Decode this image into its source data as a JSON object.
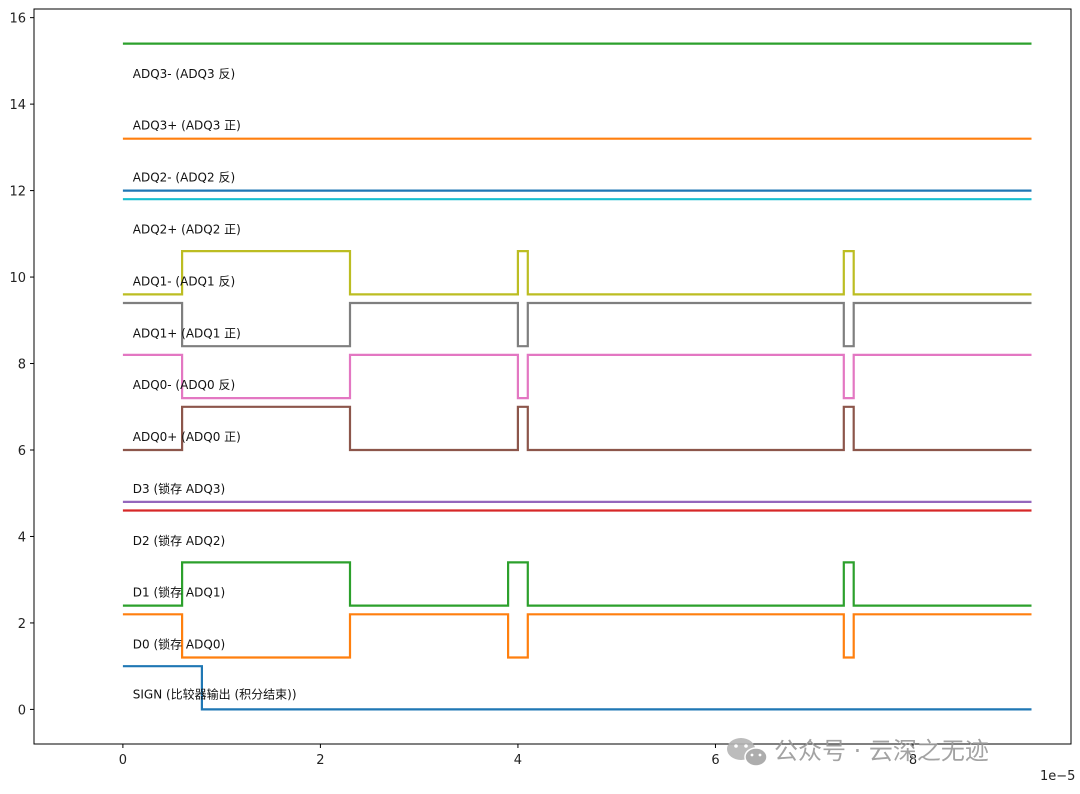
{
  "chart_data": {
    "type": "line",
    "title": "",
    "xlabel": "",
    "ylabel": "",
    "x_scale_label": "1e−5",
    "xlim": [
      -9e-06,
      9.6e-05
    ],
    "ylim": [
      -0.8,
      16.2
    ],
    "x_ticks": [
      0,
      2e-05,
      4e-05,
      6e-05,
      8e-05
    ],
    "x_tick_labels": [
      "0",
      "2",
      "4",
      "6",
      "8"
    ],
    "y_ticks": [
      0,
      2,
      4,
      6,
      8,
      10,
      12,
      14,
      16
    ],
    "y_tick_labels": [
      "0",
      "2",
      "4",
      "6",
      "8",
      "10",
      "12",
      "14",
      "16"
    ],
    "grid": false,
    "legend": "none",
    "signal_labels": [
      {
        "text": "SIGN (比较器输出 (积分结束))",
        "y": 0.35
      },
      {
        "text": "D0 (锁存 ADQ0)",
        "y": 1.5
      },
      {
        "text": "D1 (锁存 ADQ1)",
        "y": 2.7
      },
      {
        "text": "D2 (锁存 ADQ2)",
        "y": 3.9
      },
      {
        "text": "D3 (锁存 ADQ3)",
        "y": 5.1
      },
      {
        "text": "ADQ0+ (ADQ0 正)",
        "y": 6.3
      },
      {
        "text": "ADQ0- (ADQ0 反)",
        "y": 7.5
      },
      {
        "text": "ADQ1+ (ADQ1 正)",
        "y": 8.7
      },
      {
        "text": "ADQ1- (ADQ1 反)",
        "y": 9.9
      },
      {
        "text": "ADQ2+ (ADQ2 正)",
        "y": 11.1
      },
      {
        "text": "ADQ2- (ADQ2 反)",
        "y": 12.3
      },
      {
        "text": "ADQ3+ (ADQ3 正)",
        "y": 13.5
      },
      {
        "text": "ADQ3- (ADQ3 反)",
        "y": 14.7
      }
    ],
    "series": [
      {
        "color": "#1f77b4",
        "x": [
          0,
          8e-06,
          8e-06,
          9.2e-05
        ],
        "y": [
          1,
          1,
          0,
          0
        ]
      },
      {
        "color": "#ff7f0e",
        "x": [
          0,
          6e-06,
          6e-06,
          2.3e-05,
          2.3e-05,
          3.9e-05,
          3.9e-05,
          4.1e-05,
          4.1e-05,
          7.3e-05,
          7.3e-05,
          7.4e-05,
          7.4e-05,
          9.2e-05
        ],
        "y": [
          2.2,
          2.2,
          1.2,
          1.2,
          2.2,
          2.2,
          1.2,
          1.2,
          2.2,
          2.2,
          1.2,
          1.2,
          2.2,
          2.2
        ]
      },
      {
        "color": "#2ca02c",
        "x": [
          0,
          6e-06,
          6e-06,
          2.3e-05,
          2.3e-05,
          3.9e-05,
          3.9e-05,
          4.1e-05,
          4.1e-05,
          7.3e-05,
          7.3e-05,
          7.4e-05,
          7.4e-05,
          9.2e-05
        ],
        "y": [
          2.4,
          2.4,
          3.4,
          3.4,
          2.4,
          2.4,
          3.4,
          3.4,
          2.4,
          2.4,
          3.4,
          3.4,
          2.4,
          2.4
        ]
      },
      {
        "color": "#d62728",
        "x": [
          0,
          9.2e-05
        ],
        "y": [
          4.6,
          4.6
        ]
      },
      {
        "color": "#9467bd",
        "x": [
          0,
          9.2e-05
        ],
        "y": [
          4.8,
          4.8
        ]
      },
      {
        "color": "#8c564b",
        "x": [
          0,
          6e-06,
          6e-06,
          2.3e-05,
          2.3e-05,
          4e-05,
          4e-05,
          4.1e-05,
          4.1e-05,
          7.3e-05,
          7.3e-05,
          7.4e-05,
          7.4e-05,
          9.2e-05
        ],
        "y": [
          6,
          6,
          7,
          7,
          6,
          6,
          7,
          7,
          6,
          6,
          7,
          7,
          6,
          6
        ]
      },
      {
        "color": "#e377c2",
        "x": [
          0,
          6e-06,
          6e-06,
          2.3e-05,
          2.3e-05,
          4e-05,
          4e-05,
          4.1e-05,
          4.1e-05,
          7.3e-05,
          7.3e-05,
          7.4e-05,
          7.4e-05,
          9.2e-05
        ],
        "y": [
          8.2,
          8.2,
          7.2,
          7.2,
          8.2,
          8.2,
          7.2,
          7.2,
          8.2,
          8.2,
          7.2,
          7.2,
          8.2,
          8.2
        ]
      },
      {
        "color": "#7f7f7f",
        "x": [
          0,
          6e-06,
          6e-06,
          2.3e-05,
          2.3e-05,
          4e-05,
          4e-05,
          4.1e-05,
          4.1e-05,
          7.3e-05,
          7.3e-05,
          7.4e-05,
          7.4e-05,
          9.2e-05
        ],
        "y": [
          9.4,
          9.4,
          8.4,
          8.4,
          9.4,
          9.4,
          8.4,
          8.4,
          9.4,
          9.4,
          8.4,
          8.4,
          9.4,
          9.4
        ]
      },
      {
        "color": "#bcbd22",
        "x": [
          0,
          6e-06,
          6e-06,
          2.3e-05,
          2.3e-05,
          4e-05,
          4e-05,
          4.1e-05,
          4.1e-05,
          7.3e-05,
          7.3e-05,
          7.4e-05,
          7.4e-05,
          9.2e-05
        ],
        "y": [
          9.6,
          9.6,
          10.6,
          10.6,
          9.6,
          9.6,
          10.6,
          10.6,
          9.6,
          9.6,
          10.6,
          10.6,
          9.6,
          9.6
        ]
      },
      {
        "color": "#17becf",
        "x": [
          0,
          9.2e-05
        ],
        "y": [
          11.8,
          11.8
        ]
      },
      {
        "color": "#1f77b4",
        "x": [
          0,
          9.2e-05
        ],
        "y": [
          12,
          12
        ]
      },
      {
        "color": "#ff7f0e",
        "x": [
          0,
          9.2e-05
        ],
        "y": [
          13.2,
          13.2
        ]
      },
      {
        "color": "#2ca02c",
        "x": [
          0,
          9.2e-05
        ],
        "y": [
          15.4,
          15.4
        ]
      }
    ]
  },
  "watermark": {
    "text": "公众号 · 云深之无迹",
    "icon": "wechat-icon"
  }
}
